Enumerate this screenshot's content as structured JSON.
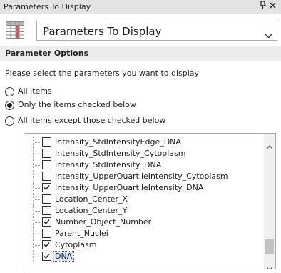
{
  "window": {
    "title": "Parameters To Display",
    "pin_icon": "pin-icon",
    "close_icon": "close-icon"
  },
  "header": {
    "icon": "grid-icon",
    "selector_value": "Parameters To Display"
  },
  "section": {
    "title": "Parameter Options"
  },
  "prompt": "Please select the parameters you want to display",
  "radio_options": [
    {
      "label": "All items",
      "selected": false
    },
    {
      "label": "Only the items checked below",
      "selected": true
    },
    {
      "label": "All items except those checked below",
      "selected": false
    }
  ],
  "items": [
    {
      "label": "Intensity_StdIntensityEdge_DNA",
      "checked": false
    },
    {
      "label": "Intensity_StdIntensity_Cytoplasm",
      "checked": false
    },
    {
      "label": "Intensity_StdIntensity_DNA",
      "checked": false
    },
    {
      "label": "Intensity_UpperQuartileIntensity_Cytoplasm",
      "checked": false
    },
    {
      "label": "Intensity_UpperQuartileIntensity_DNA",
      "checked": true
    },
    {
      "label": "Location_Center_X",
      "checked": false
    },
    {
      "label": "Location_Center_Y",
      "checked": false
    },
    {
      "label": "Number_Object_Number",
      "checked": true
    },
    {
      "label": "Parent_Nuclei",
      "checked": false
    },
    {
      "label": "Cytoplasm",
      "checked": true
    },
    {
      "label": "DNA",
      "checked": true,
      "selected": true
    }
  ],
  "colors": {
    "accent_grid": "#c0392b",
    "selection": "#d9e8fb"
  }
}
